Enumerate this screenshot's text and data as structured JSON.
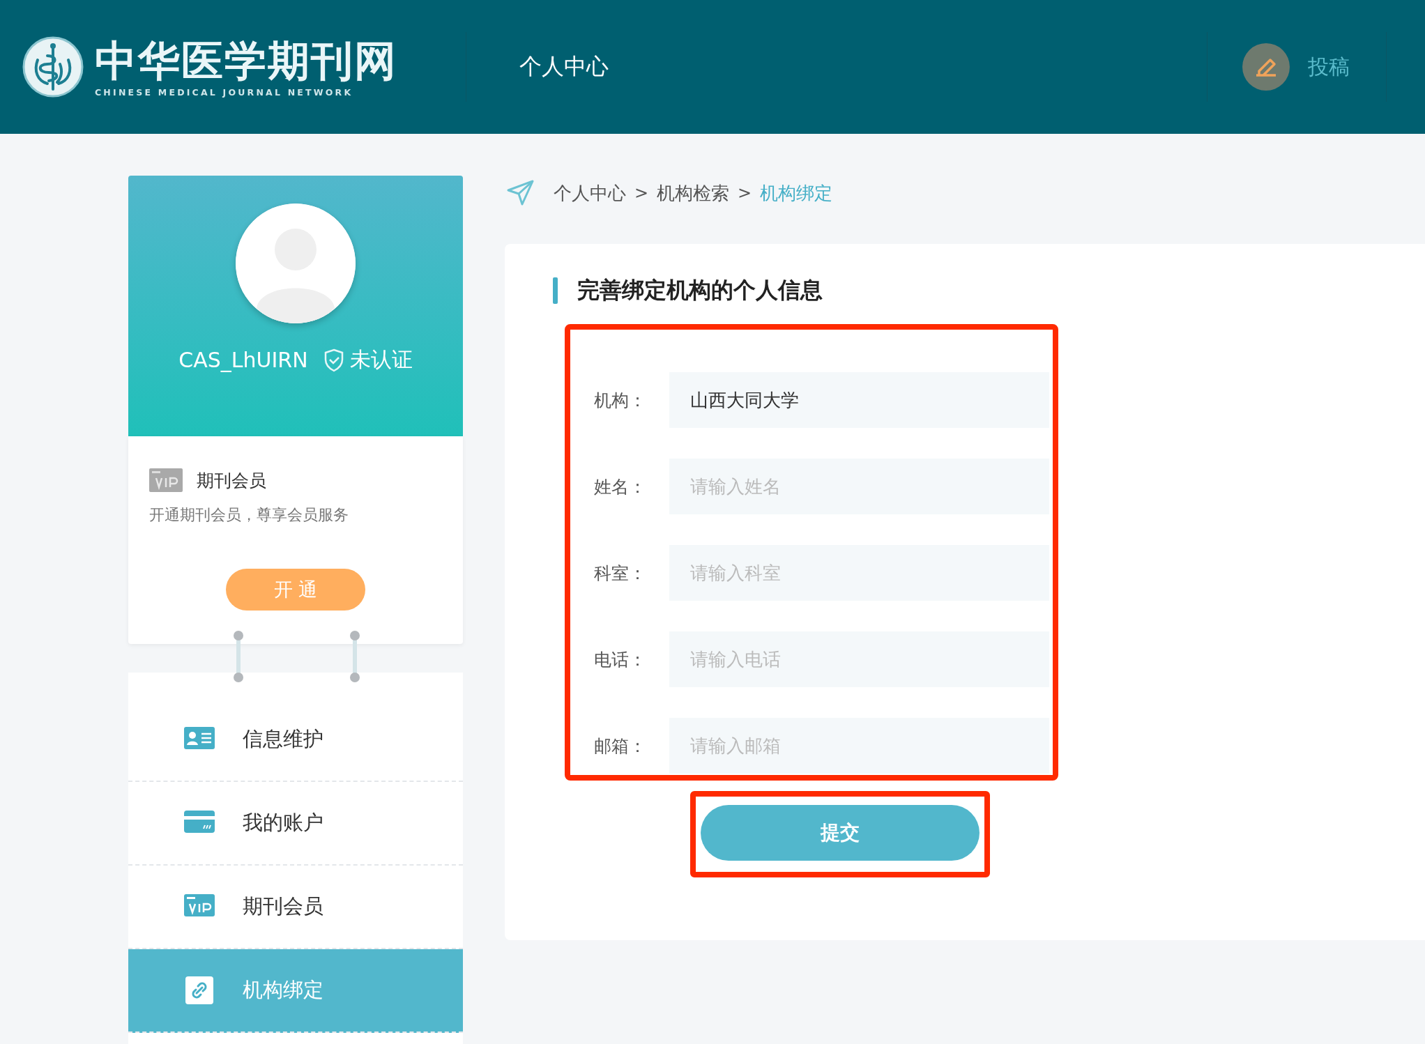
{
  "header": {
    "logo_title": "中华医学期刊网",
    "logo_subtitle": "CHINESE MEDICAL JOURNAL NETWORK",
    "nav_title": "个人中心",
    "submit_link": "投稿"
  },
  "profile": {
    "username": "CAS_LhUIRN",
    "verified": false,
    "verify_label": "未认证",
    "vip_title": "期刊会员",
    "vip_desc": "开通期刊会员，尊享会员服务",
    "open_button": "开 通"
  },
  "menu": [
    {
      "label": "信息维护",
      "kind": "profile",
      "selected": false
    },
    {
      "label": "我的账户",
      "kind": "card",
      "selected": false
    },
    {
      "label": "期刊会员",
      "kind": "vip",
      "selected": false
    },
    {
      "label": "机构绑定",
      "kind": "link",
      "selected": true
    }
  ],
  "breadcrumb": {
    "separator": ">",
    "items": [
      {
        "label": "个人中心",
        "selected": false
      },
      {
        "label": "机构检索",
        "selected": false
      },
      {
        "label": "机构绑定",
        "selected": true
      }
    ]
  },
  "form": {
    "title": "完善绑定机构的个人信息",
    "fields": [
      {
        "label": "机构：",
        "value": "山西大同大学"
      },
      {
        "label": "姓名：",
        "placeholder": "请输入姓名"
      },
      {
        "label": "科室：",
        "placeholder": "请输入科室"
      },
      {
        "label": "电话：",
        "placeholder": "请输入电话"
      },
      {
        "label": "邮箱：",
        "placeholder": "请输入邮箱"
      }
    ],
    "submit": "提交"
  }
}
